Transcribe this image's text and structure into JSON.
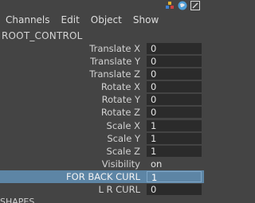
{
  "menu": {
    "channels": "Channels",
    "edit": "Edit",
    "object": "Object",
    "show": "Show"
  },
  "top_icons": [
    "channel-box-icon",
    "globe-icon",
    "edit-icon"
  ],
  "node": {
    "title": "ROOT_CONTROL"
  },
  "attributes": [
    {
      "label": "Translate X",
      "value": "0"
    },
    {
      "label": "Translate Y",
      "value": "0"
    },
    {
      "label": "Translate Z",
      "value": "0"
    },
    {
      "label": "Rotate X",
      "value": "0"
    },
    {
      "label": "Rotate Y",
      "value": "0"
    },
    {
      "label": "Rotate Z",
      "value": "0"
    },
    {
      "label": "Scale X",
      "value": "1"
    },
    {
      "label": "Scale Y",
      "value": "1"
    },
    {
      "label": "Scale Z",
      "value": "1"
    },
    {
      "label": "Visibility",
      "value": "on"
    },
    {
      "label": "FOR BACK CURL",
      "value": "1"
    },
    {
      "label": "L R CURL",
      "value": "0"
    }
  ],
  "selected_attribute": "FOR BACK CURL",
  "shapes": {
    "title": "SHAPES"
  },
  "colors": {
    "background": "#444444",
    "field": "#2b2b2b",
    "selection": "#5d85a5"
  }
}
